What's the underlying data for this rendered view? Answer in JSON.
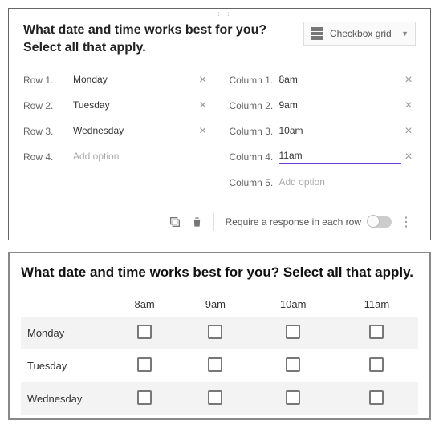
{
  "editor": {
    "question": "What date and time works best for you? Select all that apply.",
    "type_label": "Checkbox grid",
    "row_prefix": "Row",
    "col_prefix": "Column",
    "rows": [
      "Monday",
      "Tuesday",
      "Wednesday"
    ],
    "row_add_index": "4",
    "row_add_placeholder": "Add option",
    "columns": [
      "8am",
      "9am",
      "10am",
      "11am"
    ],
    "col_active_index": 3,
    "col_add_index": "5",
    "col_add_placeholder": "Add option",
    "footer": {
      "require_label": "Require a response in each row",
      "require_on": false
    }
  },
  "preview": {
    "question": "What date and time works best for you? Select all that apply.",
    "columns": [
      "8am",
      "9am",
      "10am",
      "11am"
    ],
    "rows": [
      "Monday",
      "Tuesday",
      "Wednesday"
    ]
  }
}
